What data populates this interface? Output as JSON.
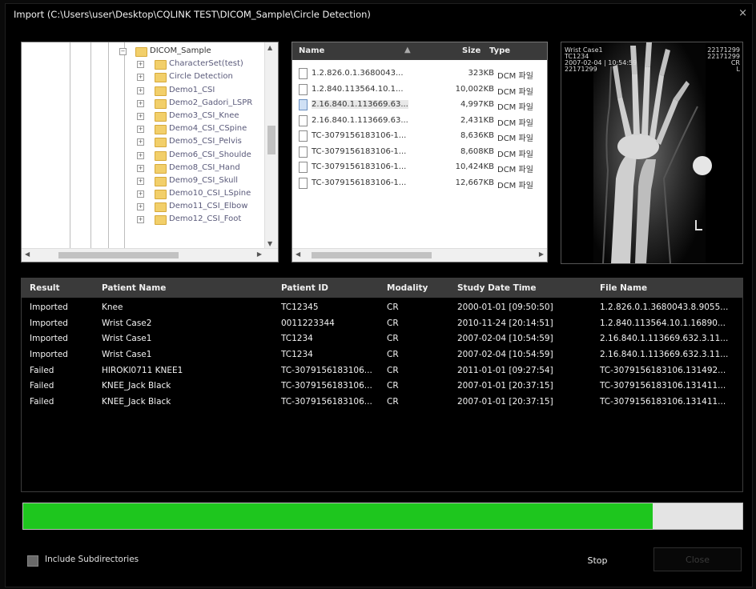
{
  "window": {
    "title": "Import (C:\\Users\\user\\Desktop\\CQLINK TEST\\DICOM_Sample\\Circle Detection)",
    "close_glyph": "×"
  },
  "tree": {
    "items": [
      {
        "label": "DICOM_Sample",
        "expander": "⊟",
        "root": true
      },
      {
        "label": "CharacterSet(test)"
      },
      {
        "label": "Circle Detection"
      },
      {
        "label": "Demo1_CSI"
      },
      {
        "label": "Demo2_Gadori_LSPR"
      },
      {
        "label": "Demo3_CSI_Knee"
      },
      {
        "label": "Demo4_CSI_CSpine"
      },
      {
        "label": "Demo5_CSI_Pelvis"
      },
      {
        "label": "Demo6_CSI_Shoulde"
      },
      {
        "label": "Demo8_CSI_Hand"
      },
      {
        "label": "Demo9_CSI_Skull"
      },
      {
        "label": "Demo10_CSI_LSpine"
      },
      {
        "label": "Demo11_CSI_Elbow"
      },
      {
        "label": "Demo12_CSI_Foot"
      }
    ]
  },
  "files": {
    "columns": {
      "name": "Name",
      "size": "Size",
      "type": "Type"
    },
    "rows": [
      {
        "name": "1.2.826.0.1.3680043...",
        "size": "323KB",
        "type": "DCM 파일"
      },
      {
        "name": "1.2.840.113564.10.1...",
        "size": "10,002KB",
        "type": "DCM 파일"
      },
      {
        "name": "2.16.840.1.113669.63...",
        "size": "4,997KB",
        "type": "DCM 파일",
        "selected": true
      },
      {
        "name": "2.16.840.1.113669.63...",
        "size": "2,431KB",
        "type": "DCM 파일"
      },
      {
        "name": "TC-30791561831​06-1...",
        "size": "8,636KB",
        "type": "DCM 파일"
      },
      {
        "name": "TC-3079156183106-1...",
        "size": "8,608KB",
        "type": "DCM 파일"
      },
      {
        "name": "TC-3079156183106-1...",
        "size": "10,424KB",
        "type": "DCM 파일"
      },
      {
        "name": "TC-3079156183106-1...",
        "size": "12,667KB",
        "type": "DCM 파일"
      }
    ]
  },
  "preview": {
    "overlay_left": [
      "Wrist Case1",
      "TC1234",
      "2007-02-04 | 10:54:59",
      "22171299"
    ],
    "overlay_right": [
      "22171299",
      "22171299",
      "CR",
      "L"
    ],
    "marker": "L"
  },
  "results": {
    "columns": [
      "Result",
      "Patient Name",
      "Patient ID",
      "Modality",
      "Study Date Time",
      "File Name"
    ],
    "rows": [
      [
        "Imported",
        "Knee",
        "TC12345",
        "CR",
        "2000-01-01 [09:50:50]",
        "1.2.826.0.1.3680043.8.9055..."
      ],
      [
        "Imported",
        "Wrist Case2",
        "0011223344",
        "CR",
        "2010-11-24 [20:14:51]",
        "1.2.840.113564.10.1.16890..."
      ],
      [
        "Imported",
        "Wrist Case1",
        "TC1234",
        "CR",
        "2007-02-04 [10:54:59]",
        "2.16.840.1.113669.632.3.11..."
      ],
      [
        "Imported",
        "Wrist Case1",
        "TC1234",
        "CR",
        "2007-02-04 [10:54:59]",
        "2.16.840.1.113669.632.3.11..."
      ],
      [
        "Failed",
        "HIROKI0711 KNEE1",
        "TC-3079156183106...",
        "CR",
        "2011-01-01 [09:27:54]",
        "TC-3079156183106.131492..."
      ],
      [
        "Failed",
        "KNEE_Jack Black",
        "TC-3079156183106...",
        "CR",
        "2007-01-01 [20:37:15]",
        "TC-3079156183106.131411..."
      ],
      [
        "Failed",
        "KNEE_Jack Black",
        "TC-3079156183106...",
        "CR",
        "2007-01-01 [20:37:15]",
        "TC-3079156183106.131411..."
      ]
    ]
  },
  "progress": {
    "value": 0.875,
    "fill_color": "#1ec61e"
  },
  "footer": {
    "include_sub_label": "Include Subdirectories",
    "stop_label": "Stop",
    "close_label": "Close"
  }
}
